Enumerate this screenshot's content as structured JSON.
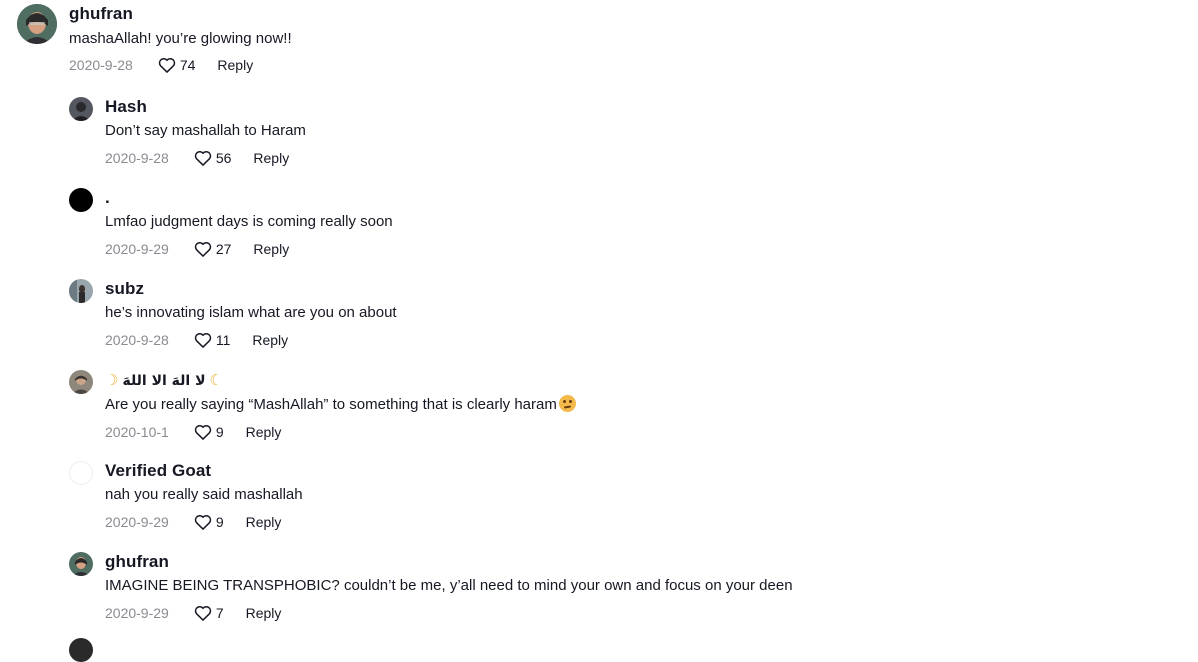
{
  "comments": [
    {
      "username": "ghufran",
      "text": "mashaAllah! you’re glowing now!!",
      "date": "2020-9-28",
      "likes": "74",
      "reply_label": "Reply",
      "avatar_color": "#4a6b5c"
    },
    {
      "username": "Hash",
      "text": "Don’t say mashallah to Haram",
      "date": "2020-9-28",
      "likes": "56",
      "reply_label": "Reply",
      "avatar_color": "#3d3f47"
    },
    {
      "username": ".",
      "text": "Lmfao judgment days is coming really soon",
      "date": "2020-9-29",
      "likes": "27",
      "reply_label": "Reply",
      "avatar_color": "#000000"
    },
    {
      "username": "subz",
      "text": "he’s innovating islam what are you on about",
      "date": "2020-9-28",
      "likes": "11",
      "reply_label": "Reply",
      "avatar_color": "#5a6b78"
    },
    {
      "username": "لا الهَ الا اللهَ",
      "username_prefix": "☽",
      "username_suffix": "☾",
      "text": "Are you really saying “MashAllah” to something that is clearly haram",
      "text_emoji": "confused-face-emoji",
      "date": "2020-10-1",
      "likes": "9",
      "reply_label": "Reply",
      "avatar_color": "#6e6a63"
    },
    {
      "username": "Verified Goat",
      "text": "nah you really said mashallah",
      "date": "2020-9-29",
      "likes": "9",
      "reply_label": "Reply",
      "avatar_color": "#ffffff"
    },
    {
      "username": "ghufran",
      "text": "IMAGINE BEING TRANSPHOBIC? couldn’t be me, y’all need to mind your own and focus on your deen",
      "date": "2020-9-29",
      "likes": "7",
      "reply_label": "Reply",
      "avatar_color": "#4a6b5c"
    }
  ],
  "icons": {
    "like": "heart-outline-icon"
  },
  "colors": {
    "date_gray": "#8a8b91",
    "text_dark": "#161823"
  }
}
